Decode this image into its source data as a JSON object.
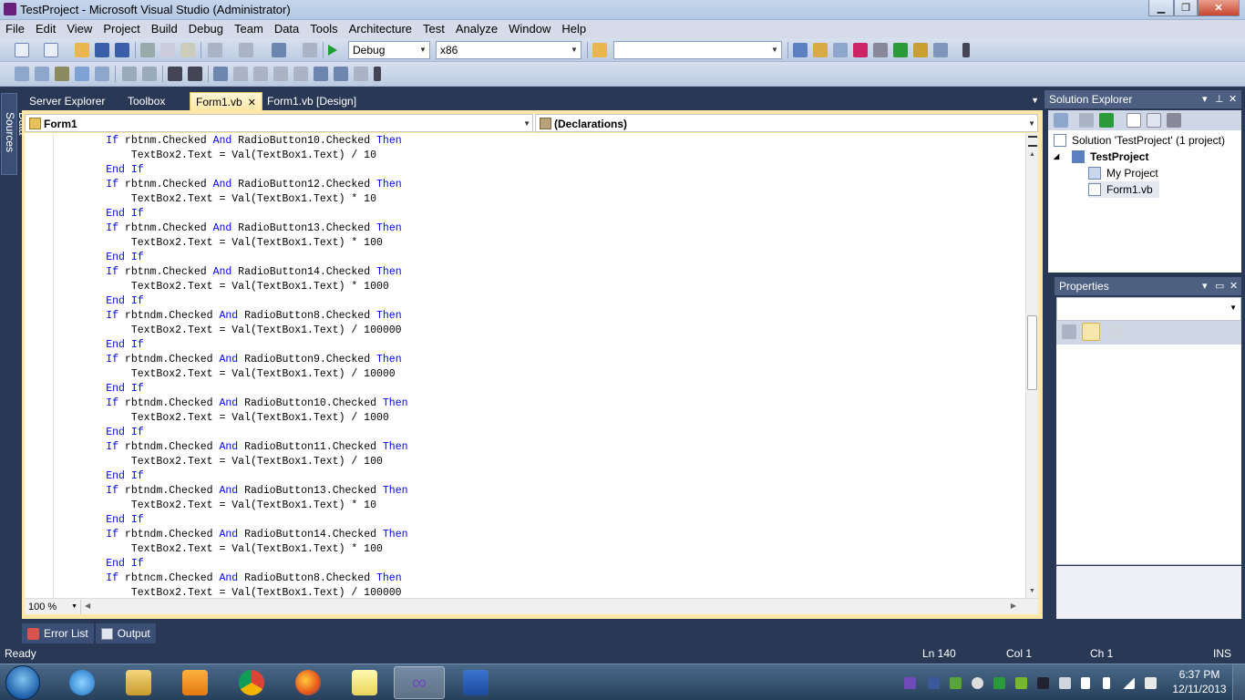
{
  "window": {
    "title": "TestProject - Microsoft Visual Studio (Administrator)",
    "controls": [
      "minimize",
      "maximize",
      "close"
    ]
  },
  "menu": [
    "File",
    "Edit",
    "View",
    "Project",
    "Build",
    "Debug",
    "Team",
    "Data",
    "Tools",
    "Architecture",
    "Test",
    "Analyze",
    "Window",
    "Help"
  ],
  "toolbar": {
    "configuration": "Debug",
    "platform": "x86",
    "find_value": ""
  },
  "left_strip": {
    "data_sources": "Data Sources"
  },
  "doc_tabs": [
    {
      "label": "Server Explorer",
      "active": false
    },
    {
      "label": "Toolbox",
      "active": false
    },
    {
      "label": "Form1.vb",
      "active": true
    },
    {
      "label": "Form1.vb [Design]",
      "active": false
    }
  ],
  "doc_tab_close": "✕",
  "editor": {
    "class_combo": "Form1",
    "member_combo": "(Declarations)",
    "zoom": "100 %",
    "code_lines": [
      {
        "indent": "        ",
        "kw1": "If",
        "a": " rbtnm.Checked ",
        "kw2": "And",
        "b": " RadioButton10.Checked ",
        "kw3": "Then"
      },
      {
        "indent": "            ",
        "plain": "TextBox2.Text = Val(TextBox1.Text) / 10"
      },
      {
        "indent": "        ",
        "end": "End If"
      },
      {
        "indent": "        ",
        "kw1": "If",
        "a": " rbtnm.Checked ",
        "kw2": "And",
        "b": " RadioButton12.Checked ",
        "kw3": "Then"
      },
      {
        "indent": "            ",
        "plain": "TextBox2.Text = Val(TextBox1.Text) * 10"
      },
      {
        "indent": "        ",
        "end": "End If"
      },
      {
        "indent": "        ",
        "kw1": "If",
        "a": " rbtnm.Checked ",
        "kw2": "And",
        "b": " RadioButton13.Checked ",
        "kw3": "Then"
      },
      {
        "indent": "            ",
        "plain": "TextBox2.Text = Val(TextBox1.Text) * 100"
      },
      {
        "indent": "        ",
        "end": "End If"
      },
      {
        "indent": "        ",
        "kw1": "If",
        "a": " rbtnm.Checked ",
        "kw2": "And",
        "b": " RadioButton14.Checked ",
        "kw3": "Then"
      },
      {
        "indent": "            ",
        "plain": "TextBox2.Text = Val(TextBox1.Text) * 1000"
      },
      {
        "indent": "        ",
        "end": "End If"
      },
      {
        "indent": "        ",
        "kw1": "If",
        "a": " rbtndm.Checked ",
        "kw2": "And",
        "b": " RadioButton8.Checked ",
        "kw3": "Then"
      },
      {
        "indent": "            ",
        "plain": "TextBox2.Text = Val(TextBox1.Text) / 100000"
      },
      {
        "indent": "        ",
        "end": "End If"
      },
      {
        "indent": "        ",
        "kw1": "If",
        "a": " rbtndm.Checked ",
        "kw2": "And",
        "b": " RadioButton9.Checked ",
        "kw3": "Then"
      },
      {
        "indent": "            ",
        "plain": "TextBox2.Text = Val(TextBox1.Text) / 10000"
      },
      {
        "indent": "        ",
        "end": "End If"
      },
      {
        "indent": "        ",
        "kw1": "If",
        "a": " rbtndm.Checked ",
        "kw2": "And",
        "b": " RadioButton10.Checked ",
        "kw3": "Then"
      },
      {
        "indent": "            ",
        "plain": "TextBox2.Text = Val(TextBox1.Text) / 1000"
      },
      {
        "indent": "        ",
        "end": "End If"
      },
      {
        "indent": "        ",
        "kw1": "If",
        "a": " rbtndm.Checked ",
        "kw2": "And",
        "b": " RadioButton11.Checked ",
        "kw3": "Then"
      },
      {
        "indent": "            ",
        "plain": "TextBox2.Text = Val(TextBox1.Text) / 100"
      },
      {
        "indent": "        ",
        "end": "End If"
      },
      {
        "indent": "        ",
        "kw1": "If",
        "a": " rbtndm.Checked ",
        "kw2": "And",
        "b": " RadioButton13.Checked ",
        "kw3": "Then"
      },
      {
        "indent": "            ",
        "plain": "TextBox2.Text = Val(TextBox1.Text) * 10"
      },
      {
        "indent": "        ",
        "end": "End If"
      },
      {
        "indent": "        ",
        "kw1": "If",
        "a": " rbtndm.Checked ",
        "kw2": "And",
        "b": " RadioButton14.Checked ",
        "kw3": "Then"
      },
      {
        "indent": "            ",
        "plain": "TextBox2.Text = Val(TextBox1.Text) * 100"
      },
      {
        "indent": "        ",
        "end": "End If"
      },
      {
        "indent": "        ",
        "kw1": "If",
        "a": " rbtncm.Checked ",
        "kw2": "And",
        "b": " RadioButton8.Checked ",
        "kw3": "Then"
      },
      {
        "indent": "            ",
        "plain": "TextBox2.Text = Val(TextBox1.Text) / 100000"
      }
    ]
  },
  "solution_explorer": {
    "title": "Solution Explorer",
    "items": [
      {
        "label": "Solution 'TestProject' (1 project)"
      },
      {
        "label": "TestProject"
      },
      {
        "label": "My Project"
      },
      {
        "label": "Form1.vb"
      }
    ]
  },
  "properties": {
    "title": "Properties",
    "object_combo": ""
  },
  "bottom_tabs": [
    "Error List",
    "Output"
  ],
  "status": {
    "ready": "Ready",
    "ln": "Ln 140",
    "col": "Col 1",
    "ch": "Ch 1",
    "mode": "INS"
  },
  "taskbar": {
    "apps": [
      "internet-explorer",
      "file-explorer",
      "media-player",
      "chrome",
      "firefox",
      "sticky-notes",
      "visual-studio",
      "word"
    ],
    "time": "6:37 PM",
    "date": "12/11/2013"
  },
  "colors": {
    "chrome": "#293955",
    "active_tab": "#ffe8a6",
    "keyword": "#0000ff"
  }
}
